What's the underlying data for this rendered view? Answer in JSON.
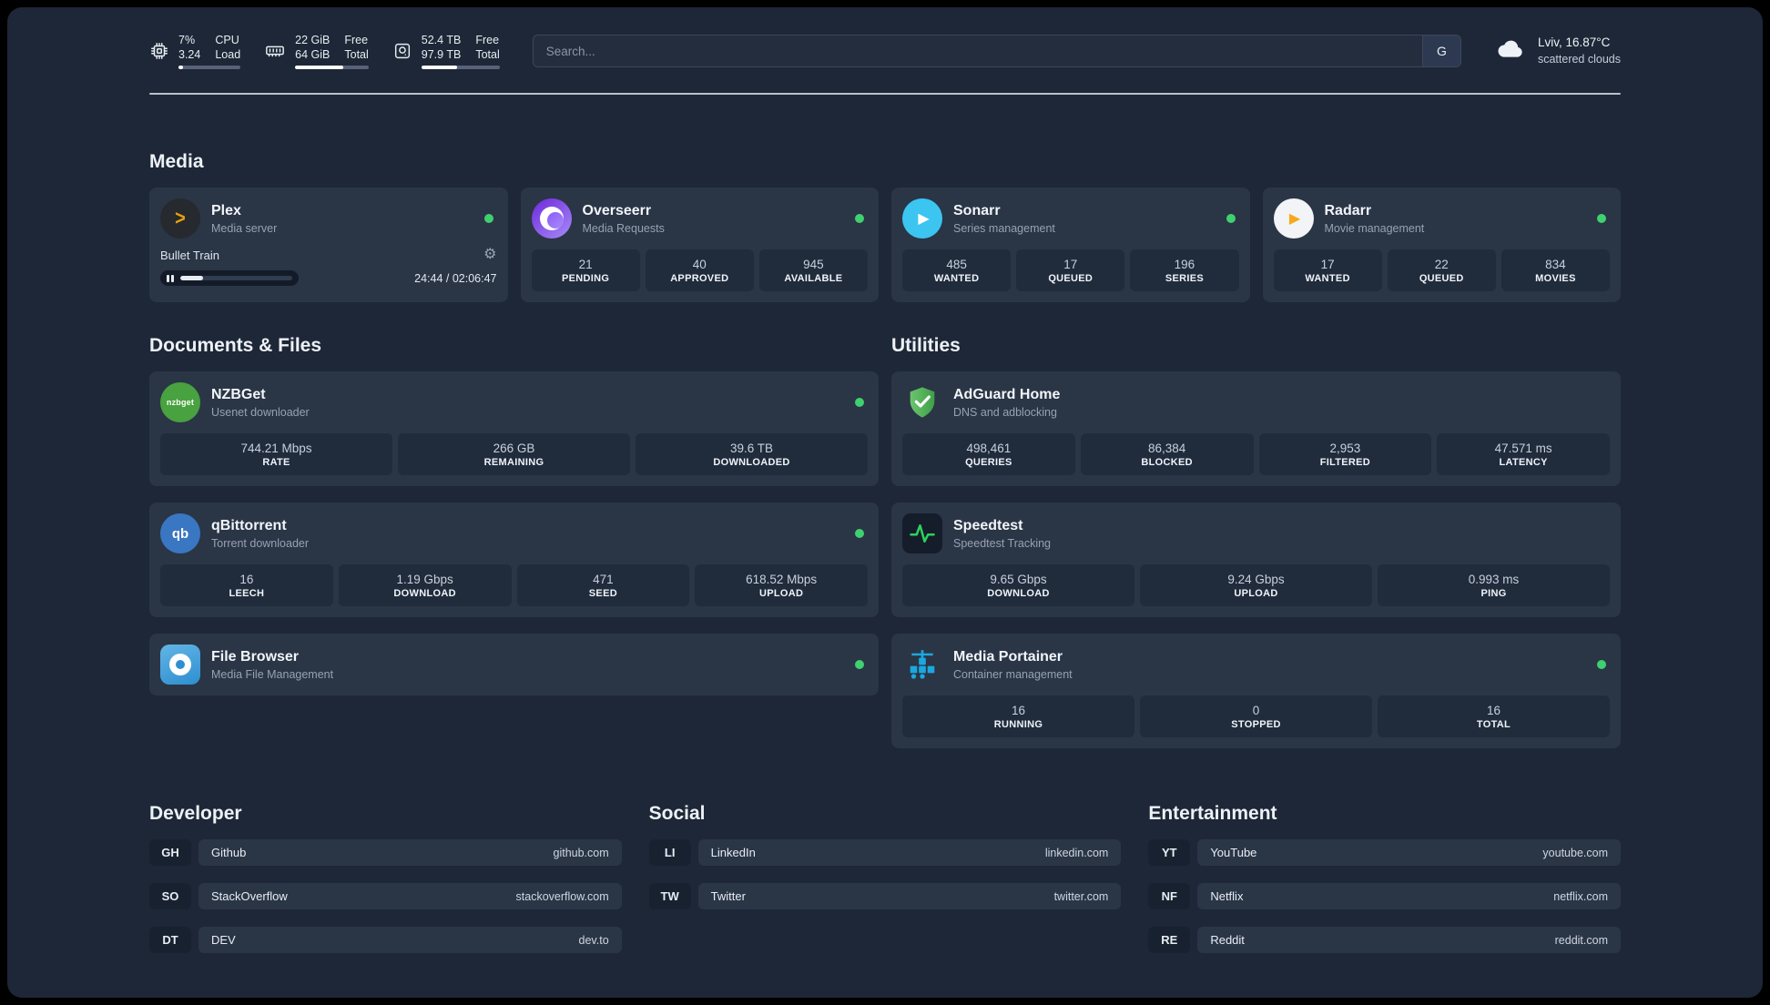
{
  "header": {
    "cpu": {
      "percent": "7%",
      "load": "3.24",
      "labels": [
        "CPU",
        "Load"
      ],
      "bar": "7%"
    },
    "memory": {
      "free": "22 GiB",
      "total": "64 GiB",
      "labels": [
        "Free",
        "Total"
      ],
      "bar": "66%"
    },
    "storage": {
      "free": "52.4 TB",
      "total": "97.9 TB",
      "labels": [
        "Free",
        "Total"
      ],
      "bar": "46%"
    },
    "search": {
      "placeholder": "Search...",
      "provider_label": "G"
    },
    "weather": {
      "location": "Lviv, 16.87°C",
      "condition": "scattered clouds"
    }
  },
  "section_titles": {
    "media": "Media",
    "documents": "Documents & Files",
    "utilities": "Utilities"
  },
  "icons": {
    "gear": "⚙",
    "plex_chevron": ">",
    "sonarr_play": "▶",
    "radarr_play": "▶",
    "nzbget_text": "nzbget",
    "qbittorrent_text": "qb"
  },
  "apps": {
    "plex": {
      "name": "Plex",
      "desc": "Media server",
      "now_playing": "Bullet Train",
      "time": "24:44 / 02:06:47",
      "progress": "20%"
    },
    "overseerr": {
      "name": "Overseerr",
      "desc": "Media Requests",
      "stats": [
        {
          "value": "21",
          "label": "PENDING"
        },
        {
          "value": "40",
          "label": "APPROVED"
        },
        {
          "value": "945",
          "label": "AVAILABLE"
        }
      ]
    },
    "sonarr": {
      "name": "Sonarr",
      "desc": "Series management",
      "stats": [
        {
          "value": "485",
          "label": "WANTED"
        },
        {
          "value": "17",
          "label": "QUEUED"
        },
        {
          "value": "196",
          "label": "SERIES"
        }
      ]
    },
    "radarr": {
      "name": "Radarr",
      "desc": "Movie management",
      "stats": [
        {
          "value": "17",
          "label": "WANTED"
        },
        {
          "value": "22",
          "label": "QUEUED"
        },
        {
          "value": "834",
          "label": "MOVIES"
        }
      ]
    },
    "nzbget": {
      "name": "NZBGet",
      "desc": "Usenet downloader",
      "stats": [
        {
          "value": "744.21 Mbps",
          "label": "RATE"
        },
        {
          "value": "266 GB",
          "label": "REMAINING"
        },
        {
          "value": "39.6 TB",
          "label": "DOWNLOADED"
        }
      ]
    },
    "qbittorrent": {
      "name": "qBittorrent",
      "desc": "Torrent downloader",
      "stats": [
        {
          "value": "16",
          "label": "LEECH"
        },
        {
          "value": "1.19 Gbps",
          "label": "DOWNLOAD"
        },
        {
          "value": "471",
          "label": "SEED"
        },
        {
          "value": "618.52 Mbps",
          "label": "UPLOAD"
        }
      ]
    },
    "filebrowser": {
      "name": "File Browser",
      "desc": "Media File Management"
    },
    "adguard": {
      "name": "AdGuard Home",
      "desc": "DNS and adblocking",
      "stats": [
        {
          "value": "498,461",
          "label": "QUERIES"
        },
        {
          "value": "86,384",
          "label": "BLOCKED"
        },
        {
          "value": "2,953",
          "label": "FILTERED"
        },
        {
          "value": "47.571 ms",
          "label": "LATENCY"
        }
      ]
    },
    "speedtest": {
      "name": "Speedtest",
      "desc": "Speedtest Tracking",
      "stats": [
        {
          "value": "9.65 Gbps",
          "label": "DOWNLOAD"
        },
        {
          "value": "9.24 Gbps",
          "label": "UPLOAD"
        },
        {
          "value": "0.993 ms",
          "label": "PING"
        }
      ]
    },
    "portainer": {
      "name": "Media Portainer",
      "desc": "Container management",
      "stats": [
        {
          "value": "16",
          "label": "RUNNING"
        },
        {
          "value": "0",
          "label": "STOPPED"
        },
        {
          "value": "16",
          "label": "TOTAL"
        }
      ]
    }
  },
  "bookmarks": {
    "developer": {
      "title": "Developer",
      "items": [
        {
          "abbr": "GH",
          "name": "Github",
          "url": "github.com"
        },
        {
          "abbr": "SO",
          "name": "StackOverflow",
          "url": "stackoverflow.com"
        },
        {
          "abbr": "DT",
          "name": "DEV",
          "url": "dev.to"
        }
      ]
    },
    "social": {
      "title": "Social",
      "items": [
        {
          "abbr": "LI",
          "name": "LinkedIn",
          "url": "linkedin.com"
        },
        {
          "abbr": "TW",
          "name": "Twitter",
          "url": "twitter.com"
        }
      ]
    },
    "entertainment": {
      "title": "Entertainment",
      "items": [
        {
          "abbr": "YT",
          "name": "YouTube",
          "url": "youtube.com"
        },
        {
          "abbr": "NF",
          "name": "Netflix",
          "url": "netflix.com"
        },
        {
          "abbr": "RE",
          "name": "Reddit",
          "url": "reddit.com"
        }
      ]
    }
  }
}
